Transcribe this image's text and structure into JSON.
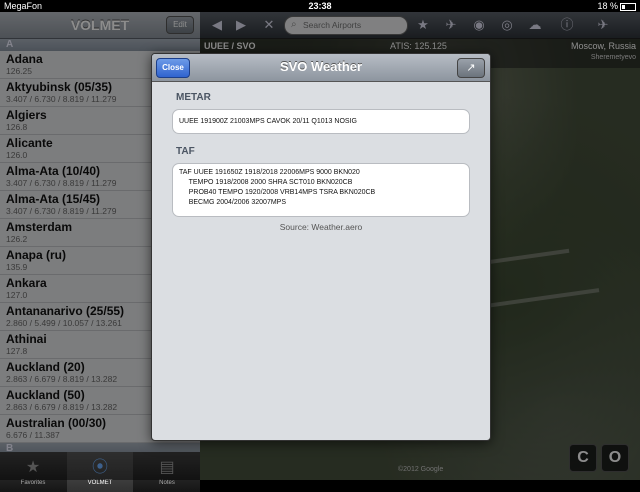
{
  "status": {
    "carrier": "MegaFon",
    "time": "23:38",
    "battery": "18 %"
  },
  "sidebar": {
    "title": "VOLMET",
    "edit_label": "Edit",
    "sections": [
      {
        "header": "A"
      },
      {
        "header": "B"
      }
    ],
    "items": [
      {
        "name": "Adana",
        "freq": "126.25"
      },
      {
        "name": "Aktyubinsk (05/35)",
        "freq": "3.407 / 6.730 / 8.819 / 11.279"
      },
      {
        "name": "Algiers",
        "freq": "126.8"
      },
      {
        "name": "Alicante",
        "freq": "126.0"
      },
      {
        "name": "Alma-Ata (10/40)",
        "freq": "3.407 / 6.730 / 8.819 / 11.279"
      },
      {
        "name": "Alma-Ata (15/45)",
        "freq": "3.407 / 6.730 / 8.819 / 11.279"
      },
      {
        "name": "Amsterdam",
        "freq": "126.2"
      },
      {
        "name": "Anapa (ru)",
        "freq": "135.9"
      },
      {
        "name": "Ankara",
        "freq": "127.0"
      },
      {
        "name": "Antananarivo (25/55)",
        "freq": "2.860 / 5.499 / 10.057 / 13.261"
      },
      {
        "name": "Athinai",
        "freq": "127.8"
      },
      {
        "name": "Auckland (20)",
        "freq": "2.863 / 6.679 / 8.819 / 13.282"
      },
      {
        "name": "Auckland (50)",
        "freq": "2.863 / 6.679 / 8.819 / 13.282"
      },
      {
        "name": "Australian (00/30)",
        "freq": "6.676 / 11.387"
      }
    ],
    "tabs": [
      {
        "label": "Favorites",
        "icon": "star-icon"
      },
      {
        "label": "VOLMET",
        "icon": "radio-tower-icon"
      },
      {
        "label": "Notes",
        "icon": "notepad-icon"
      }
    ]
  },
  "map": {
    "search_placeholder": "Search Airports",
    "airport_code": "UUEE / SVO",
    "atis": "ATIS: 125.125",
    "city": "Moscow, Russia",
    "airport_name": "Sheremetyevo",
    "copyright": "©2012 Google",
    "btn_c": "C",
    "btn_o": "O"
  },
  "modal": {
    "title": "SVO Weather",
    "close_label": "Close",
    "metar_label": "METAR",
    "metar_text": "UUEE 191900Z 21003MPS CAVOK 20/11 Q1013 NOSIG",
    "taf_label": "TAF",
    "taf_text": "TAF UUEE 191650Z 1918/2018 22006MPS 9000 BKN020\n     TEMPO 1918/2008 2000 SHRA SCT010 BKN020CB\n     PROB40 TEMPO 1920/2008 VRB14MPS TSRA BKN020CB\n     BECMG 2004/2006 32007MPS",
    "source": "Source: Weather.aero"
  },
  "colors": {
    "accent": "#2f63cf",
    "toolbar": "#3f454c",
    "sidebar_bg": "#e2e3e5"
  }
}
